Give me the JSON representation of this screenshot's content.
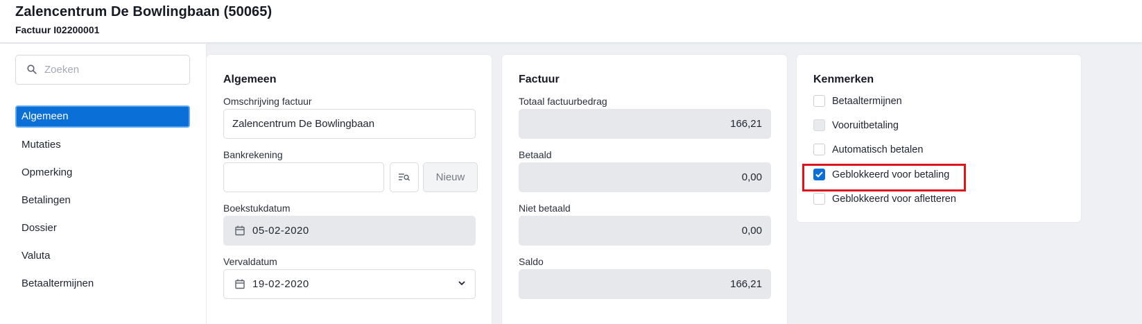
{
  "header": {
    "title": "Zalencentrum De Bowlingbaan (50065)",
    "subtitle": "Factuur I02200001"
  },
  "sidebar": {
    "search_placeholder": "Zoeken",
    "items": [
      {
        "label": "Algemeen",
        "active": true
      },
      {
        "label": "Mutaties"
      },
      {
        "label": "Opmerking"
      },
      {
        "label": "Betalingen"
      },
      {
        "label": "Dossier"
      },
      {
        "label": "Valuta"
      },
      {
        "label": "Betaaltermijnen"
      }
    ]
  },
  "algemeen": {
    "title": "Algemeen",
    "omschrijving_label": "Omschrijving factuur",
    "omschrijving_value": "Zalencentrum De Bowlingbaan",
    "bankrekening_label": "Bankrekening",
    "bankrekening_value": "",
    "nieuw_label": "Nieuw",
    "boekstukdatum_label": "Boekstukdatum",
    "boekstukdatum_value": "05-02-2020",
    "vervaldatum_label": "Vervaldatum",
    "vervaldatum_value": "19-02-2020"
  },
  "factuur": {
    "title": "Factuur",
    "totaal_label": "Totaal factuurbedrag",
    "totaal_value": "166,21",
    "betaald_label": "Betaald",
    "betaald_value": "0,00",
    "niet_betaald_label": "Niet betaald",
    "niet_betaald_value": "0,00",
    "saldo_label": "Saldo",
    "saldo_value": "166,21"
  },
  "kenmerken": {
    "title": "Kenmerken",
    "items": [
      {
        "label": "Betaaltermijnen",
        "checked": false
      },
      {
        "label": "Vooruitbetaling",
        "checked": false,
        "disabled": true
      },
      {
        "label": "Automatisch betalen",
        "checked": false
      },
      {
        "label": "Geblokkeerd voor betaling",
        "checked": true,
        "highlighted": true
      },
      {
        "label": "Geblokkeerd voor afletteren",
        "checked": false
      }
    ]
  },
  "colors": {
    "accent": "#0a70d8",
    "highlight": "#e0121b"
  }
}
